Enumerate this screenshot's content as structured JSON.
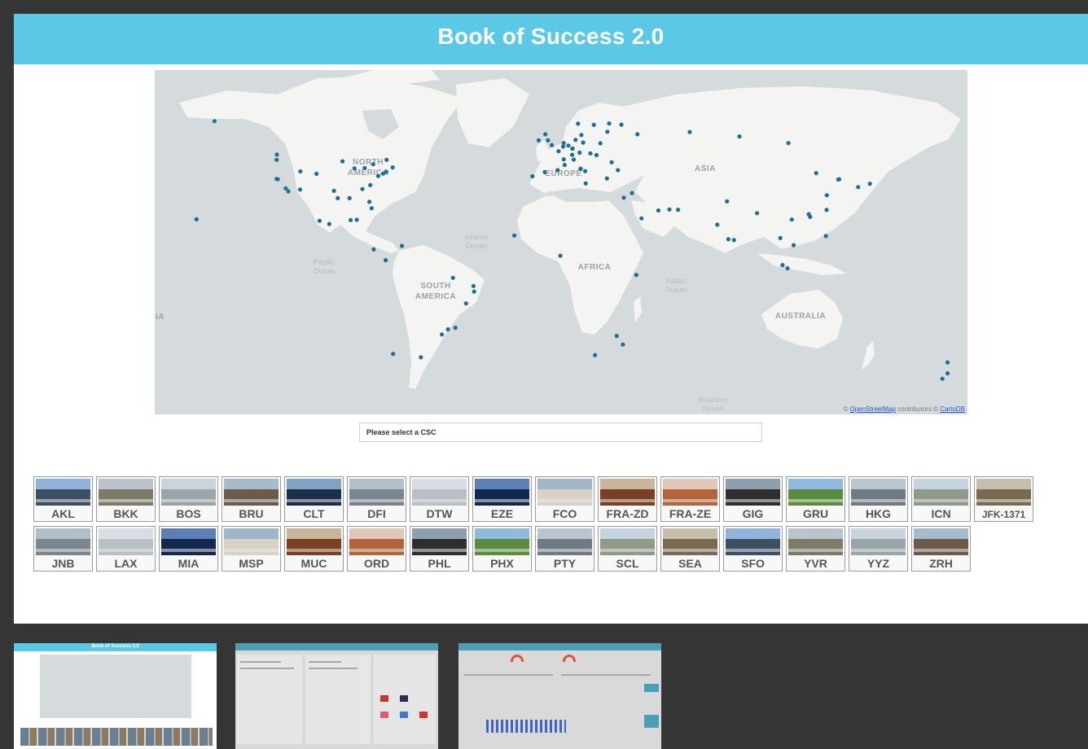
{
  "header": {
    "title": "Book of Success 2.0"
  },
  "map": {
    "labels": {
      "north_america": [
        "NORTH",
        "AMERICA"
      ],
      "south_america": [
        "SOUTH",
        "AMERICA"
      ],
      "europe": "EUROPE",
      "asia": "ASIA",
      "africa": "AFRICA",
      "australia": "AUSTRALIA",
      "atlantic": [
        "Atlantic",
        "Ocean"
      ],
      "pacific": [
        "Pacific",
        "Ocean"
      ],
      "indian": [
        "Indian",
        "Ocean"
      ],
      "southern": [
        "Southern",
        "Ocean"
      ],
      "edge": "IA"
    },
    "attribution": {
      "prefix": "© ",
      "osm": "OpenStreetMap",
      "middle": " contributors © ",
      "carto": "CartoDB"
    },
    "marker_color": "#1f6e96",
    "locations": [
      [
        -149.9,
        61.2
      ],
      [
        -122.3,
        47.6
      ],
      [
        -122.4,
        45.5
      ],
      [
        -121.9,
        37.6
      ],
      [
        -122.4,
        37.7
      ],
      [
        -118.4,
        33.9
      ],
      [
        -117.2,
        32.7
      ],
      [
        -112.0,
        33.4
      ],
      [
        -104.7,
        39.8
      ],
      [
        -111.9,
        40.8
      ],
      [
        -97.0,
        32.9
      ],
      [
        -95.3,
        29.9
      ],
      [
        -93.2,
        44.9
      ],
      [
        -90.1,
        29.9
      ],
      [
        -87.9,
        42.0
      ],
      [
        -84.4,
        33.6
      ],
      [
        -83.4,
        42.2
      ],
      [
        -80.9,
        35.2
      ],
      [
        -80.3,
        25.8
      ],
      [
        -81.3,
        28.4
      ],
      [
        -77.4,
        38.9
      ],
      [
        -75.2,
        39.9
      ],
      [
        -73.8,
        40.6
      ],
      [
        -71.0,
        42.4
      ],
      [
        -79.6,
        43.7
      ],
      [
        -73.7,
        45.5
      ],
      [
        -99.1,
        19.4
      ],
      [
        -103.4,
        20.7
      ],
      [
        -86.9,
        21.1
      ],
      [
        -89.6,
        21.0
      ],
      [
        -79.4,
        9.1
      ],
      [
        -74.1,
        4.7
      ],
      [
        -66.9,
        10.5
      ],
      [
        -157.9,
        21.3
      ],
      [
        -46.5,
        -23.4
      ],
      [
        -43.2,
        -22.8
      ],
      [
        -38.5,
        -12.9
      ],
      [
        -34.9,
        -8.1
      ],
      [
        -35.2,
        -5.8
      ],
      [
        -49.2,
        -25.5
      ],
      [
        -58.5,
        -34.8
      ],
      [
        -70.8,
        -33.4
      ],
      [
        -44.3,
        -2.5
      ],
      [
        -0.5,
        51.5
      ],
      [
        -2.2,
        53.4
      ],
      [
        -3.4,
        55.9
      ],
      [
        -6.3,
        53.4
      ],
      [
        2.5,
        49.0
      ],
      [
        4.8,
        45.7
      ],
      [
        5.2,
        43.4
      ],
      [
        2.1,
        41.3
      ],
      [
        -3.6,
        40.5
      ],
      [
        -9.1,
        38.8
      ],
      [
        4.5,
        50.9
      ],
      [
        4.8,
        52.3
      ],
      [
        8.6,
        50.0
      ],
      [
        8.7,
        50.1
      ],
      [
        11.8,
        48.4
      ],
      [
        13.4,
        52.5
      ],
      [
        10.0,
        53.6
      ],
      [
        6.8,
        51.3
      ],
      [
        8.5,
        47.5
      ],
      [
        9.2,
        45.6
      ],
      [
        12.3,
        41.8
      ],
      [
        12.2,
        41.9
      ],
      [
        14.3,
        40.9
      ],
      [
        16.6,
        48.1
      ],
      [
        19.3,
        47.4
      ],
      [
        21.0,
        52.2
      ],
      [
        18.1,
        59.7
      ],
      [
        11.1,
        60.2
      ],
      [
        12.6,
        55.6
      ],
      [
        24.9,
        60.3
      ],
      [
        24.1,
        56.9
      ],
      [
        30.3,
        59.8
      ],
      [
        37.4,
        55.9
      ],
      [
        28.8,
        41.3
      ],
      [
        23.9,
        37.9
      ],
      [
        35.0,
        32.0
      ],
      [
        26.0,
        44.5
      ],
      [
        14.5,
        35.9
      ],
      [
        31.4,
        30.1
      ],
      [
        39.2,
        21.7
      ],
      [
        55.4,
        25.2
      ],
      [
        51.6,
        25.3
      ],
      [
        46.7,
        24.9
      ],
      [
        60.6,
        56.8
      ],
      [
        82.6,
        55.0
      ],
      [
        104.3,
        52.3
      ],
      [
        -17.1,
        14.7
      ],
      [
        3.3,
        6.5
      ],
      [
        36.9,
        -1.3
      ],
      [
        28.2,
        -26.1
      ],
      [
        31.0,
        -29.6
      ],
      [
        18.6,
        -33.9
      ],
      [
        77.1,
        28.6
      ],
      [
        72.8,
        19.1
      ],
      [
        77.7,
        13.2
      ],
      [
        80.2,
        12.9
      ],
      [
        90.4,
        23.8
      ],
      [
        100.7,
        13.7
      ],
      [
        101.7,
        2.7
      ],
      [
        103.9,
        1.4
      ],
      [
        106.6,
        10.8
      ],
      [
        105.8,
        21.2
      ],
      [
        113.9,
        22.3
      ],
      [
        116.6,
        40.1
      ],
      [
        121.3,
        31.1
      ],
      [
        113.3,
        23.4
      ],
      [
        126.4,
        37.5
      ],
      [
        126.8,
        37.6
      ],
      [
        121.2,
        25.1
      ],
      [
        120.9,
        14.5
      ],
      [
        140.4,
        35.8
      ],
      [
        135.2,
        34.4
      ],
      [
        174.8,
        -36.9
      ],
      [
        172.5,
        -43.5
      ],
      [
        174.8,
        -41.3
      ]
    ]
  },
  "select": {
    "placeholder": "Please select a CSC"
  },
  "tiles_row1": [
    "AKL",
    "BKK",
    "BOS",
    "BRU",
    "CLT",
    "DFI",
    "DTW",
    "EZE",
    "FCO",
    "FRA-ZD",
    "FRA-ZE",
    "GIG",
    "GRU",
    "HKG",
    "ICN",
    "JFK-1371"
  ],
  "tiles_row2": [
    "JNB",
    "LAX",
    "MIA",
    "MSP",
    "MUC",
    "ORD",
    "PHL",
    "PHX",
    "PTY",
    "SCL",
    "SEA",
    "SFO",
    "YVR",
    "YYZ",
    "ZRH"
  ],
  "thumbnails": {
    "sheet1_title": "Book of Success 2.0"
  },
  "colors": {
    "header": "#5bc8e6",
    "background": "#353535"
  }
}
